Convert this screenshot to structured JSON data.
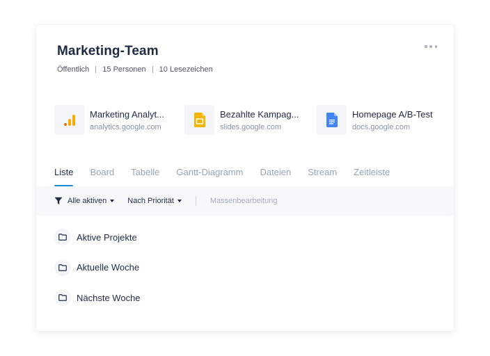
{
  "board": {
    "title": "Marketing-Team",
    "visibility": "Öffentlich",
    "members": "15 Personen",
    "bookmarks_count": "10 Lesezeichen"
  },
  "bookmarks": [
    {
      "title": "Marketing Analyt...",
      "url": "analytics.google.com",
      "icon": "google-analytics-icon",
      "color": "#f9ab00"
    },
    {
      "title": "Bezahlte Kampag...",
      "url": "slides.google.com",
      "icon": "google-slides-icon",
      "color": "#f4b400"
    },
    {
      "title": "Homepage A/B-Test",
      "url": "docs.google.com",
      "icon": "google-docs-icon",
      "color": "#4285f4"
    }
  ],
  "tabs": [
    "Liste",
    "Board",
    "Tabelle",
    "Gantt-Diagramm",
    "Dateien",
    "Stream",
    "Zeitleiste"
  ],
  "active_tab": "Liste",
  "toolbar": {
    "filter_label": "Alle aktiven",
    "sort_label": "Nach Priorität",
    "bulk_edit_label": "Massenbearbeitung"
  },
  "lists": [
    "Aktive Projekte",
    "Aktuelle Woche",
    "Nächste Woche"
  ],
  "colors": {
    "accent": "#1a8ad6",
    "text": "#1f2a44",
    "muted": "#9aa3b2"
  }
}
